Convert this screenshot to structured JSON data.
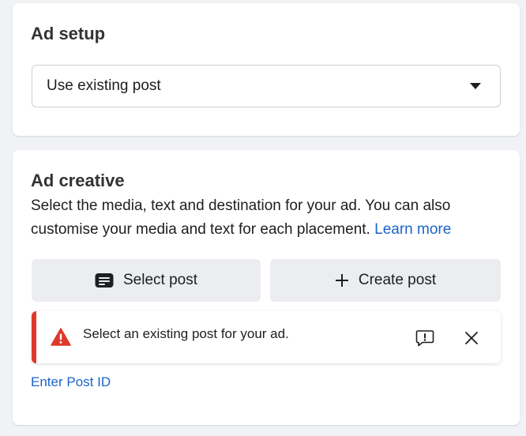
{
  "ad_setup": {
    "title": "Ad setup",
    "dropdown_value": "Use existing post"
  },
  "ad_creative": {
    "title": "Ad creative",
    "description": "Select the media, text and destination for your ad. You can also customise your media and text for each placement.",
    "learn_more": "Learn more",
    "select_post_label": "Select post",
    "create_post_label": "Create post",
    "alert_text": "Select an existing post for your ad.",
    "enter_post_id": "Enter Post ID"
  },
  "colors": {
    "link": "#1b64c9",
    "error": "#e0392b",
    "button_bg": "#ebedf0"
  },
  "icons": {
    "select_post": "post-icon",
    "create_post": "plus-icon",
    "alert": "warning-icon",
    "feedback": "feedback-icon",
    "close": "close-icon",
    "dropdown": "caret-down-icon"
  }
}
